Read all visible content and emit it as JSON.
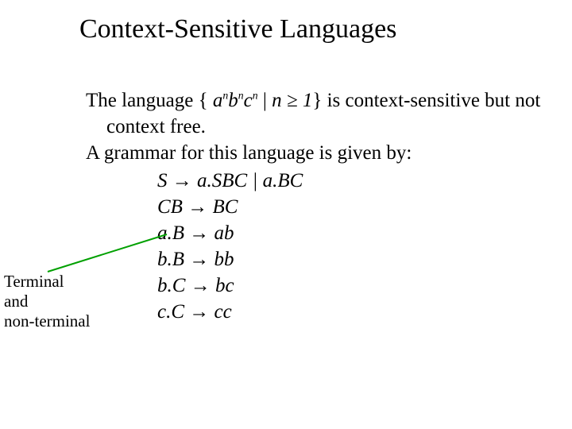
{
  "title": "Context-Sensitive Languages",
  "intro": {
    "line1_prefix": " The language { ",
    "a": "a",
    "b": "b",
    "c": "c",
    "n": "n",
    "line1_mid": " | ",
    "line1_cond": "n ≥ 1",
    "line1_suffix": "} is context-sensitive",
    "line1_cont": "but not context free.",
    "line2": "A grammar for this language is given by:"
  },
  "rules": {
    "r1_lhs": "S ",
    "r1_arrow": "→",
    "r1_rhs": " a.SBC | a.BC",
    "r2_lhs": "CB ",
    "r2_arrow": "→",
    "r2_rhs": " BC",
    "r3_lhs": "a.B ",
    "r3_arrow": "→",
    "r3_rhs": " ab",
    "r4_lhs": "b.B ",
    "r4_arrow": "→",
    "r4_rhs": " bb",
    "r5_lhs": "b.C ",
    "r5_arrow": "→",
    "r5_rhs": " bc",
    "r6_lhs": "c.C ",
    "r6_arrow": "→",
    "r6_rhs": " cc"
  },
  "annot": {
    "l1": "Terminal",
    "l2": "and",
    "l3": "non-terminal"
  },
  "colors": {
    "line": "#00a000"
  }
}
